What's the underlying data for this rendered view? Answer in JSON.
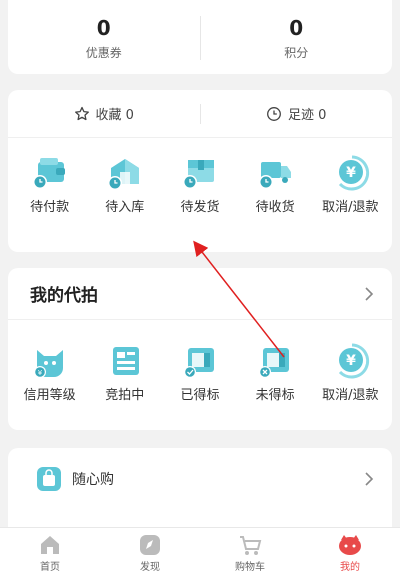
{
  "stats": {
    "coupons": {
      "value": "0",
      "label": "优惠券"
    },
    "points": {
      "value": "0",
      "label": "积分"
    }
  },
  "favorites": {
    "collect_label": "收藏 0",
    "footprint_label": "足迹 0"
  },
  "orders": {
    "items": [
      {
        "label": "待付款",
        "icon": "wallet-clock-icon"
      },
      {
        "label": "待入库",
        "icon": "warehouse-clock-icon"
      },
      {
        "label": "待发货",
        "icon": "box-clock-icon"
      },
      {
        "label": "待收货",
        "icon": "truck-clock-icon"
      },
      {
        "label": "取消/退款",
        "icon": "yen-refund-icon"
      }
    ]
  },
  "daipai": {
    "title": "我的代拍",
    "items": [
      {
        "label": "信用等级",
        "icon": "cat-credit-icon"
      },
      {
        "label": "竞拍中",
        "icon": "auction-board-icon"
      },
      {
        "label": "已得标",
        "icon": "won-bid-icon"
      },
      {
        "label": "未得标",
        "icon": "lost-bid-icon"
      },
      {
        "label": "取消/退款",
        "icon": "yen-refund-icon"
      }
    ]
  },
  "suixin": {
    "label": "随心购",
    "icon": "shopping-bag-icon"
  },
  "tabbar": {
    "items": [
      {
        "label": "首页",
        "icon": "home-icon",
        "active": false
      },
      {
        "label": "发现",
        "icon": "compass-icon",
        "active": false
      },
      {
        "label": "购物车",
        "icon": "cart-icon",
        "active": false
      },
      {
        "label": "我的",
        "icon": "profile-icon",
        "active": true
      }
    ]
  },
  "colors": {
    "accent": "#5cc6d6",
    "active_tab": "#e84a4a",
    "annotation_arrow": "#e02020"
  }
}
